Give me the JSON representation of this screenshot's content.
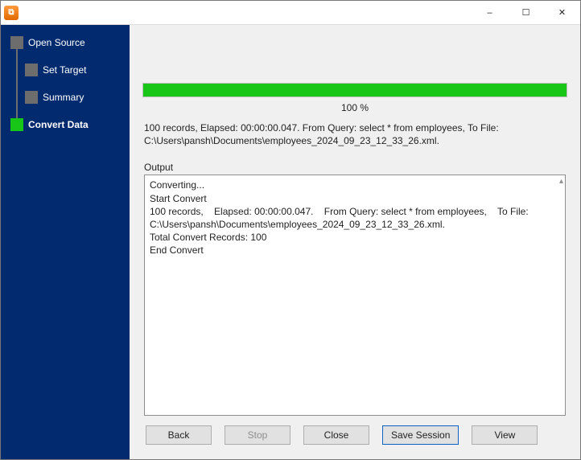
{
  "window": {
    "title": ""
  },
  "sidebar": {
    "items": [
      {
        "label": "Open Source",
        "level": 0,
        "current": false
      },
      {
        "label": "Set Target",
        "level": 1,
        "current": false
      },
      {
        "label": "Summary",
        "level": 1,
        "current": false
      },
      {
        "label": "Convert Data",
        "level": 0,
        "current": true
      }
    ]
  },
  "progress": {
    "percent_label": "100 %",
    "fill_percent": 100
  },
  "summary_text": "100 records,    Elapsed: 00:00:00.047.    From Query: select * from employees,    To File: C:\\Users\\pansh\\Documents\\employees_2024_09_23_12_33_26.xml.",
  "output": {
    "label": "Output",
    "text": "Converting...\nStart Convert\n100 records,    Elapsed: 00:00:00.047.    From Query: select * from employees,    To File: C:\\Users\\pansh\\Documents\\employees_2024_09_23_12_33_26.xml.\nTotal Convert Records: 100\nEnd Convert"
  },
  "buttons": {
    "back": "Back",
    "stop": "Stop",
    "close": "Close",
    "save_session": "Save Session",
    "view": "View"
  }
}
